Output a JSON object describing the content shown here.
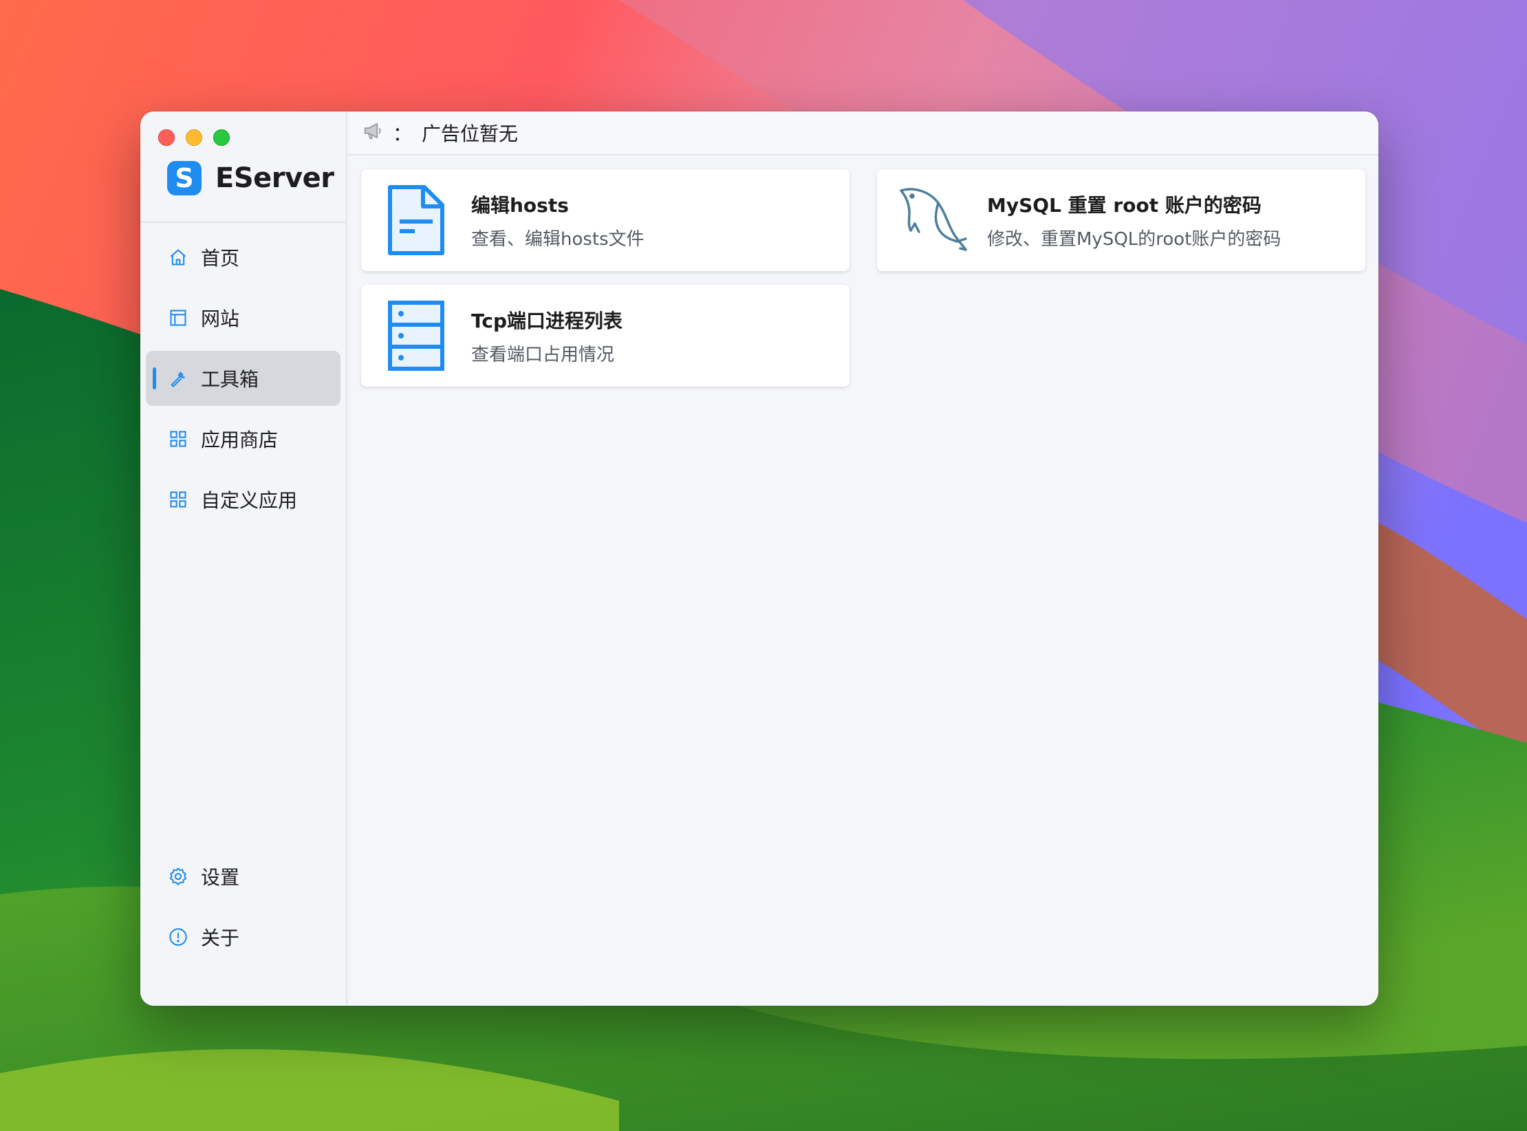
{
  "app": {
    "name": "EServer",
    "logo_letter": "S"
  },
  "colors": {
    "accent": "#1e8cf0",
    "active_bg": "#d7d8dd"
  },
  "ad_bar": {
    "icon": "megaphone-icon",
    "separator": "：",
    "text": "广告位暂无"
  },
  "sidebar": {
    "items": [
      {
        "label": "首页",
        "icon": "home-icon",
        "active": false
      },
      {
        "label": "网站",
        "icon": "website-icon",
        "active": false
      },
      {
        "label": "工具箱",
        "icon": "wrench-icon",
        "active": true
      },
      {
        "label": "应用商店",
        "icon": "grid-icon",
        "active": false
      },
      {
        "label": "自定义应用",
        "icon": "grid-icon",
        "active": false
      }
    ],
    "bottom_items": [
      {
        "label": "设置",
        "icon": "gear-icon"
      },
      {
        "label": "关于",
        "icon": "info-icon"
      }
    ]
  },
  "tools": [
    {
      "title": "编辑hosts",
      "desc": "查看、编辑hosts文件",
      "icon": "document-icon"
    },
    {
      "title": "MySQL 重置 root 账户的密码",
      "desc": "修改、重置MySQL的root账户的密码",
      "icon": "dolphin-icon"
    },
    {
      "title": "Tcp端口进程列表",
      "desc": "查看端口占用情况",
      "icon": "server-list-icon"
    }
  ]
}
